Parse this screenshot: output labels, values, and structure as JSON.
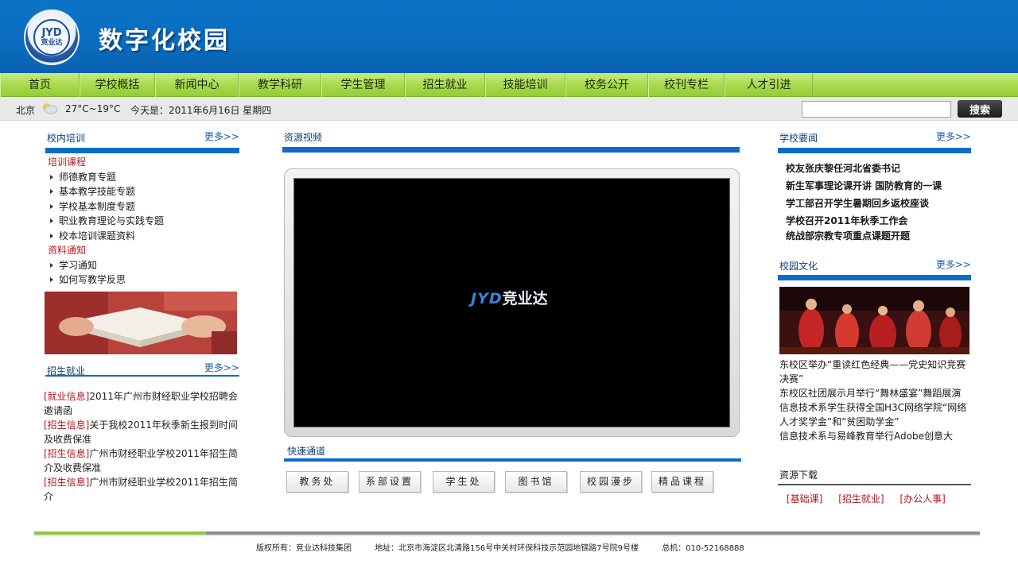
{
  "header": {
    "logo_text_en": "JYD",
    "logo_text_cn": "竞业达",
    "site_title": "数字化校园"
  },
  "nav": {
    "items": [
      "首页",
      "学校概括",
      "新闻中心",
      "教学科研",
      "学生管理",
      "招生就业",
      "技能培训",
      "校务公开",
      "校刊专栏",
      "人才引进"
    ]
  },
  "infobar": {
    "city": "北京",
    "weather_icon": "partly-cloudy-icon",
    "temperature": "27°C~19°C",
    "date": "今天是：2011年6月16日  星期四",
    "search_placeholder": "",
    "search_button": "搜索"
  },
  "left": {
    "training": {
      "title": "校内培训",
      "more": "更多>>",
      "category1": "培训课程",
      "items1": [
        "师德教育专题",
        "基本教学技能专题",
        "学校基本制度专题",
        "职业教育理论与实践专题",
        "校本培训课题资料"
      ],
      "category2": "资料通知",
      "items2": [
        "学习通知",
        "如何写教学反思"
      ]
    },
    "jobs": {
      "title": "招生就业",
      "more": "更多>>",
      "items": [
        {
          "tag": "[就业信息]",
          "text": "2011年广州市财经职业学校招聘会邀请函"
        },
        {
          "tag": "[招生信息]",
          "text": "关于我校2011年秋季新生报到时间及收费保准"
        },
        {
          "tag": "[招生信息]",
          "text": "广州市财经职业学校2011年招生简介及收费保准"
        },
        {
          "tag": "[招生信息]",
          "text": "广州市财经职业学校2011年招生简介"
        }
      ]
    }
  },
  "middle": {
    "video": {
      "title": "资源视频",
      "logo_en": "JYD",
      "logo_cn": "竞业达"
    },
    "quick": {
      "title": "快速通道",
      "buttons": [
        "教务处",
        "系部设置",
        "学生处",
        "图书馆",
        "校园漫步",
        "精品课程"
      ]
    }
  },
  "right": {
    "news": {
      "title": "学校要闻",
      "more": "更多>>",
      "items": [
        "校友张庆黎任河北省委书记",
        "新生军事理论课开讲 国防教育的一课",
        "学工部召开学生暑期回乡返校座谈",
        "学校召开2011年秋季工作会",
        "统战部宗教专项重点课题开题"
      ]
    },
    "culture": {
      "title": "校园文化",
      "more": "更多>>",
      "items": [
        "东校区举办“重读红色经典——党史知识竞赛决赛”",
        "东校区社团展示月举行“舞林盛宴”舞蹈展演",
        "信息技术系学生获得全国H3C网络学院“网络人才奖学金”和“贫困助学金”",
        "信息技术系与易峰教育举行Adobe创意大"
      ]
    },
    "downloads": {
      "title": "资源下载",
      "links": [
        "[基础课]",
        "[招生就业]",
        "[办公人事]"
      ]
    }
  },
  "footer": {
    "copyright": "版权所有：竞业达科技集团",
    "address": "地址：北京市海淀区北清路156号中关村环保科技示范园地锦路7号院9号楼",
    "phone": "总机：010-52168888"
  }
}
